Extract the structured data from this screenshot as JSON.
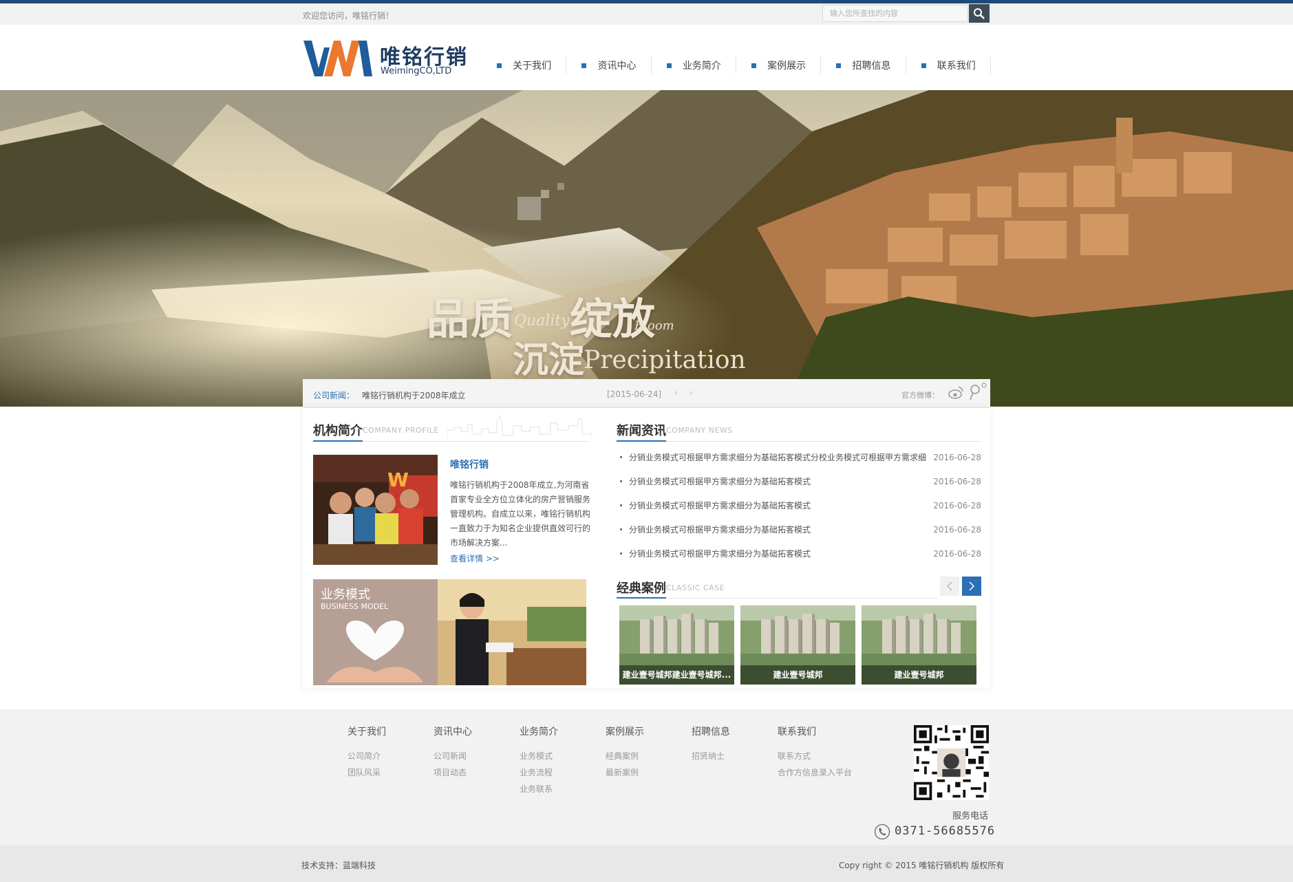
{
  "topbar": {
    "welcome": "欢迎您访问，唯铭行销！",
    "search_placeholder": "输入您所查找的内容"
  },
  "header": {
    "logo_cn": "唯铭行销",
    "logo_en": "WeimingCO,LTD",
    "logo_icon": "wm-logo"
  },
  "nav": {
    "items": [
      "关于我们",
      "资讯中心",
      "业务简介",
      "案例展示",
      "招聘信息",
      "联系我们"
    ]
  },
  "banner": {
    "slogan_1": "品质",
    "slogan_1_en": "Quality",
    "slogan_2": "绽放",
    "slogan_2_en": "Bloom",
    "slogan_3": "沉淀",
    "slogan_3_en": "Precipitation"
  },
  "news_strip": {
    "label": "公司新闻：",
    "title": "唯铭行销机构于2008年成立",
    "date": "[2015-06-24]",
    "arrows": "‹ ›",
    "weibo_label": "官方微博：",
    "icons": [
      "sina-weibo-icon",
      "tencent-weibo-icon"
    ]
  },
  "profile": {
    "title": "机构简介",
    "subtitle": "COMPANY PROFILE",
    "name": "唯铭行销",
    "desc": "唯铭行销机构于2008年成立,为河南省首家专业全方位立体化的房产营销服务管理机构。自成立以来，唯铭行销机构一直致力于为知名企业提供直效可行的市场解决方案...",
    "more": "查看详情 >>"
  },
  "business": {
    "title_cn": "业务模式",
    "title_en": "BUSINESS MODEL"
  },
  "news": {
    "title": "新闻资讯",
    "subtitle": "COMPANY NEWS",
    "items": [
      {
        "text": "分销业务模式可根据甲方需求细分为基础拓客模式分校业务模式可根据甲方需求细",
        "date": "2016-06-28"
      },
      {
        "text": "分销业务模式可根据甲方需求细分为基础拓客模式",
        "date": "2016-06-28"
      },
      {
        "text": "分销业务模式可根据甲方需求细分为基础拓客模式",
        "date": "2016-06-28"
      },
      {
        "text": "分销业务模式可根据甲方需求细分为基础拓客模式",
        "date": "2016-06-28"
      },
      {
        "text": "分销业务模式可根据甲方需求细分为基础拓客模式",
        "date": "2016-06-28"
      }
    ]
  },
  "cases": {
    "title": "经典案例",
    "subtitle": "CLASSIC CASE",
    "items": [
      {
        "caption": "建业壹号城邦建业壹号城邦..."
      },
      {
        "caption": "建业壹号城邦"
      },
      {
        "caption": "建业壹号城邦"
      }
    ]
  },
  "footer": {
    "columns": [
      {
        "head": "关于我们",
        "links": [
          "公司简介",
          "团队风采"
        ]
      },
      {
        "head": "资讯中心",
        "links": [
          "公司新闻",
          "项目动态"
        ]
      },
      {
        "head": "业务简介",
        "links": [
          "业务模式",
          "业务流程",
          "业务联系"
        ]
      },
      {
        "head": "案例展示",
        "links": [
          "经典案例",
          "最新案例"
        ]
      },
      {
        "head": "招聘信息",
        "links": [
          "招贤纳士"
        ]
      },
      {
        "head": "联系我们",
        "links": [
          "联系方式",
          "合作方信息录入平台"
        ]
      }
    ],
    "service_label": "服务电话",
    "phone": "0371-56685576"
  },
  "bottom": {
    "tech": "技术支持：蓝端科技",
    "copyright": "Copy right © 2015 唯铭行销机构 版权所有"
  },
  "colors": {
    "brand_blue": "#2b6fb4",
    "logo_orange": "#e8792e",
    "top_line": "#1c4a7a"
  }
}
